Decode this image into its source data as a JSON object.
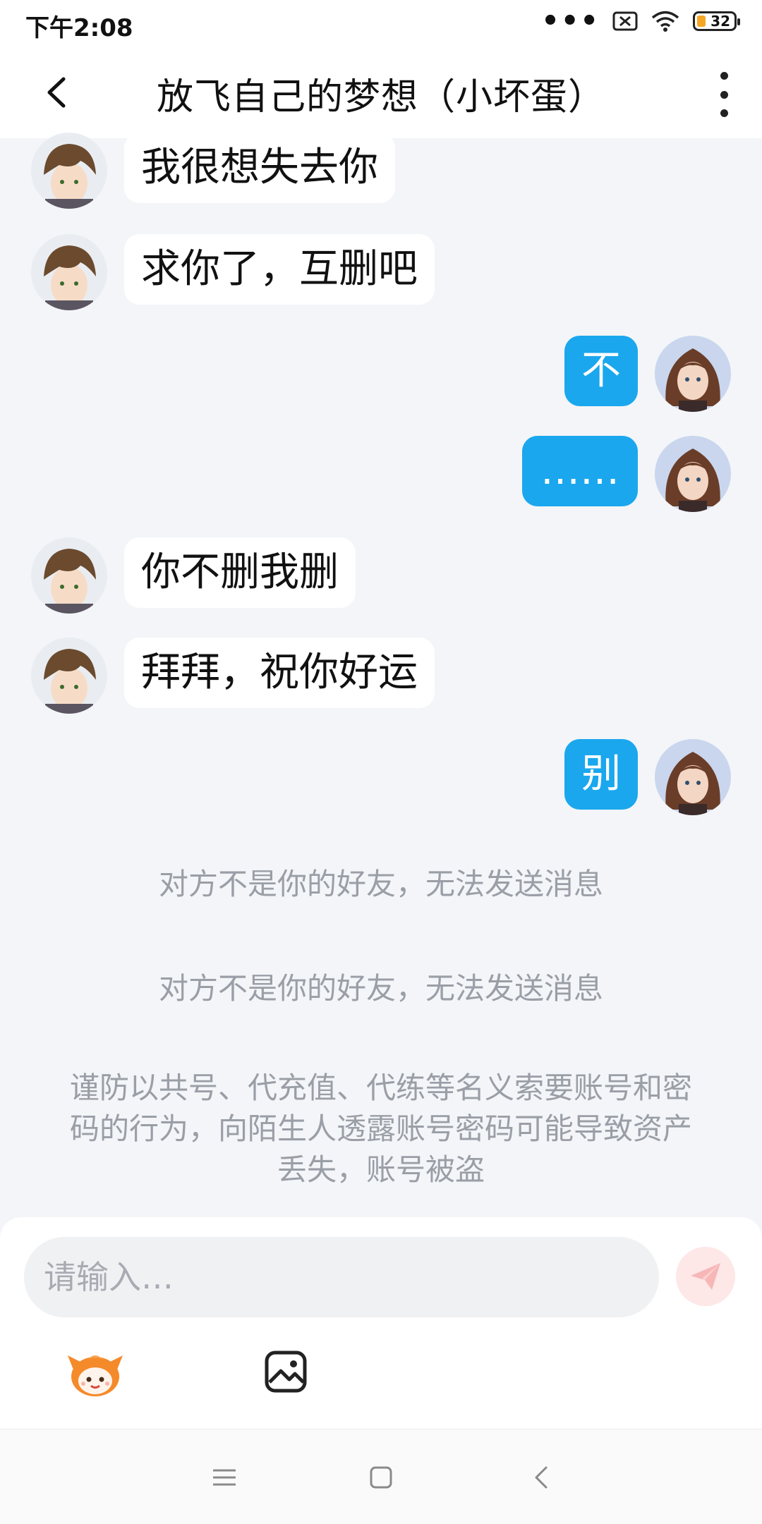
{
  "status_bar": {
    "time": "下午2:08",
    "battery": "32",
    "icons": [
      "more-dots-icon",
      "sim-x-icon",
      "wifi-icon",
      "battery-icon"
    ]
  },
  "header": {
    "title": "放飞自己的梦想（小坏蛋）",
    "back_icon": "chevron-left-icon",
    "more_icon": "more-vertical-icon"
  },
  "messages": [
    {
      "side": "left",
      "text": "我很想失去你"
    },
    {
      "side": "left",
      "text": "求你了，互删吧"
    },
    {
      "side": "right",
      "text": "不"
    },
    {
      "side": "right",
      "text": "……"
    },
    {
      "side": "left",
      "text": "你不删我删"
    },
    {
      "side": "left",
      "text": "拜拜，祝你好运"
    },
    {
      "side": "right",
      "text": "别"
    }
  ],
  "system_messages": [
    "对方不是你的好友，无法发送消息",
    "对方不是你的好友，无法发送消息"
  ],
  "notice": "谨防以共号、代充值、代练等名义索要账号和密码的行为，向陌生人透露账号密码可能导致资产丢失，账号被盗",
  "composer": {
    "placeholder": "请输入…",
    "send_icon": "send-icon",
    "emoji_icon": "emoji-mascot-icon",
    "image_icon": "image-icon"
  },
  "colors": {
    "accent": "#1aa7ee",
    "background": "#f3f5f8",
    "system_text": "#9a9ea6"
  }
}
